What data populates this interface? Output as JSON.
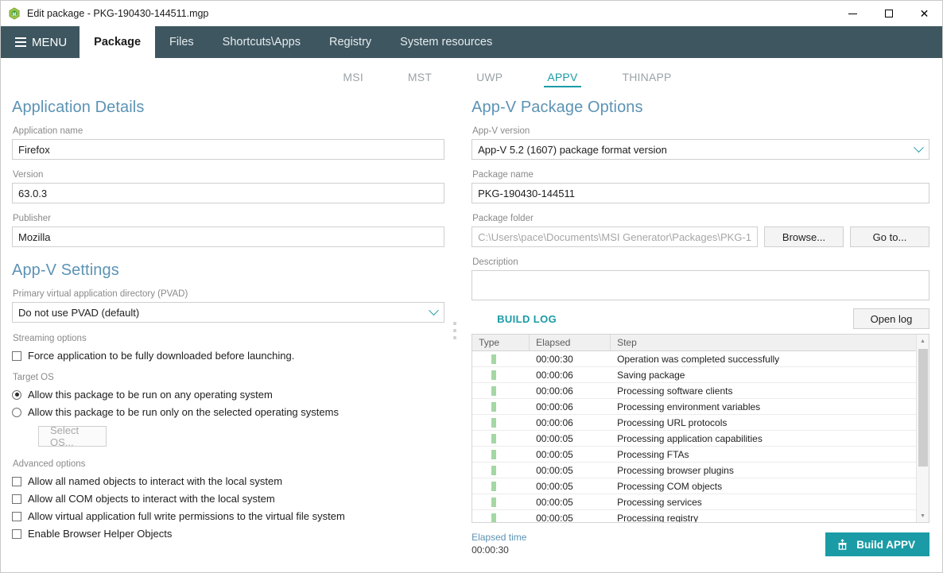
{
  "window": {
    "title": "Edit package - PKG-190430-144511.mgp",
    "app_icon": "green-hexagon-m-icon",
    "minimize_label": "Minimize",
    "maximize_label": "Maximize",
    "close_label": "Close"
  },
  "menu": {
    "label": "MENU",
    "icon": "hamburger-icon"
  },
  "main_tabs": [
    {
      "label": "Package",
      "active": true
    },
    {
      "label": "Files",
      "active": false
    },
    {
      "label": "Shortcuts\\Apps",
      "active": false
    },
    {
      "label": "Registry",
      "active": false
    },
    {
      "label": "System resources",
      "active": false
    }
  ],
  "sub_tabs": [
    {
      "label": "MSI",
      "active": false
    },
    {
      "label": "MST",
      "active": false
    },
    {
      "label": "UWP",
      "active": false
    },
    {
      "label": "APPV",
      "active": true
    },
    {
      "label": "THINAPP",
      "active": false
    }
  ],
  "left": {
    "application_details": {
      "heading": "Application Details",
      "fields": [
        {
          "label": "Application name",
          "value": "Firefox"
        },
        {
          "label": "Version",
          "value": "63.0.3"
        },
        {
          "label": "Publisher",
          "value": "Mozilla"
        }
      ]
    },
    "appv_settings": {
      "heading": "App-V Settings",
      "pvad_label": "Primary virtual application directory (PVAD)",
      "pvad_value": "Do not use PVAD (default)",
      "streaming_label": "Streaming options",
      "streaming_checkbox": {
        "label": "Force application to be fully downloaded before launching.",
        "checked": false
      },
      "target_os_label": "Target OS",
      "target_os_options": [
        {
          "label": "Allow this package to be run on any operating system",
          "selected": true
        },
        {
          "label": "Allow this package to be run only on the selected operating systems",
          "selected": false
        }
      ],
      "select_os_button": "Select OS...",
      "advanced_label": "Advanced options",
      "advanced_options": [
        {
          "label": "Allow all named objects to interact with the local system",
          "checked": false
        },
        {
          "label": "Allow all COM objects to interact with the local system",
          "checked": false
        },
        {
          "label": "Allow virtual application full write permissions to the virtual file system",
          "checked": false
        },
        {
          "label": "Enable Browser Helper Objects",
          "checked": false
        }
      ]
    }
  },
  "right": {
    "heading": "App-V Package Options",
    "appv_version_label": "App-V version",
    "appv_version_value": "App-V 5.2 (1607) package format version",
    "package_name_label": "Package name",
    "package_name_value": "PKG-190430-144511",
    "package_folder_label": "Package folder",
    "package_folder_value": "C:\\Users\\pace\\Documents\\MSI Generator\\Packages\\PKG-1",
    "browse_button": "Browse...",
    "goto_button": "Go to...",
    "description_label": "Description",
    "description_value": "",
    "build_log_title": "BUILD LOG",
    "open_log_button": "Open log",
    "log_columns": [
      "Type",
      "Elapsed",
      "Step"
    ],
    "log_rows": [
      {
        "type": "success",
        "elapsed": "00:00:30",
        "step": "Operation was completed successfully"
      },
      {
        "type": "success",
        "elapsed": "00:00:06",
        "step": "Saving package"
      },
      {
        "type": "success",
        "elapsed": "00:00:06",
        "step": "Processing software clients"
      },
      {
        "type": "success",
        "elapsed": "00:00:06",
        "step": "Processing environment variables"
      },
      {
        "type": "success",
        "elapsed": "00:00:06",
        "step": "Processing URL protocols"
      },
      {
        "type": "success",
        "elapsed": "00:00:05",
        "step": "Processing application capabilities"
      },
      {
        "type": "success",
        "elapsed": "00:00:05",
        "step": "Processing FTAs"
      },
      {
        "type": "success",
        "elapsed": "00:00:05",
        "step": "Processing browser plugins"
      },
      {
        "type": "success",
        "elapsed": "00:00:05",
        "step": "Processing COM objects"
      },
      {
        "type": "success",
        "elapsed": "00:00:05",
        "step": "Processing services"
      },
      {
        "type": "success",
        "elapsed": "00:00:05",
        "step": "Processing registry"
      }
    ],
    "elapsed_time_label": "Elapsed time",
    "elapsed_time_value": "00:00:30",
    "build_button": "Build APPV",
    "build_button_icon": "package-box-icon"
  },
  "colors": {
    "tabstrip_bg": "#3e5660",
    "accent_teal": "#1a9ba6",
    "heading_blue": "#5c93b4",
    "status_green": "#a3d8a3"
  }
}
